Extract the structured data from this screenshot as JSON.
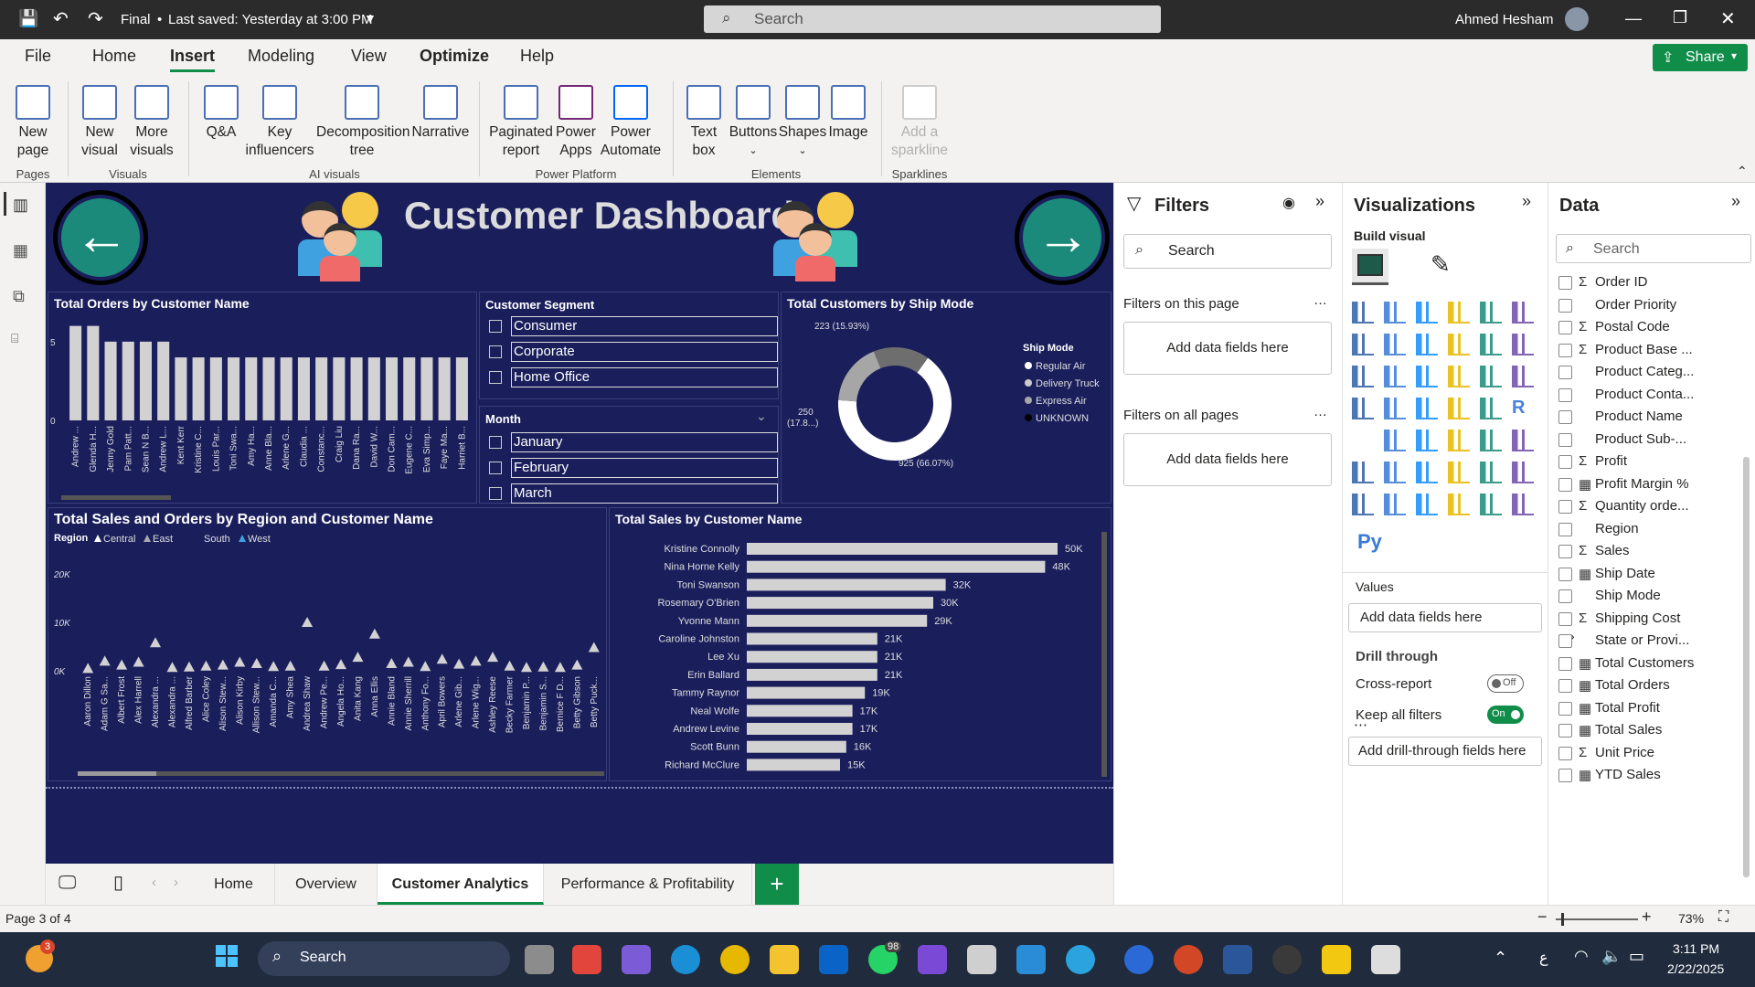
{
  "titlebar": {
    "file_title": "Final",
    "saved": "Last saved: Yesterday at 3:00 PM",
    "search_placeholder": "Search",
    "user": "Ahmed Hesham"
  },
  "ribbon": {
    "tabs": [
      "File",
      "Home",
      "Insert",
      "Modeling",
      "View",
      "Optimize",
      "Help"
    ],
    "selected_tab": "Insert",
    "share": "Share",
    "buttons": {
      "new_page": "New\npage",
      "new_visual": "New\nvisual",
      "more_visuals": "More\nvisuals",
      "qa": "Q&A",
      "key_influencers": "Key\ninfluencers",
      "decomposition": "Decomposition\ntree",
      "narrative": "Narrative",
      "paginated": "Paginated\nreport",
      "power_apps": "Power\nApps",
      "power_automate": "Power\nAutomate",
      "text_box": "Text\nbox",
      "buttons": "Buttons",
      "shapes": "Shapes",
      "image": "Image",
      "sparkline": "Add a\nsparkline"
    },
    "groups": {
      "pages": "Pages",
      "visuals": "Visuals",
      "ai": "AI visuals",
      "power_platform": "Power Platform",
      "elements": "Elements",
      "sparklines": "Sparklines"
    }
  },
  "dashboard": {
    "title": "Customer Dashboard",
    "orders_title": "Total Orders by Customer Name",
    "segment_title": "Customer Segment",
    "segments": [
      "Consumer",
      "Corporate",
      "Home Office"
    ],
    "month_title": "Month",
    "months": [
      "January",
      "February",
      "March"
    ],
    "shipmode_title": "Total Customers by Ship Mode",
    "region_title": "Total Sales and Orders by Region and Customer Name",
    "sales_title": "Total Sales by Customer Name"
  },
  "chart_data": [
    {
      "type": "bar",
      "title": "Total Orders by Customer Name",
      "categories": [
        "Andrew ...",
        "Glenda H...",
        "Jenny Gold",
        "Pam Patt...",
        "Sean N B...",
        "Andrew L...",
        "Kent Kerr",
        "Kristine C...",
        "Louis Par...",
        "Toni Swa...",
        "Amy Ha...",
        "Anne Bla...",
        "Arlene G...",
        "Claudia ...",
        "Constanc...",
        "Craig Liu",
        "Dana Ra...",
        "David W...",
        "Don Cam...",
        "Eugene C...",
        "Eva Simp...",
        "Faye Ma...",
        "Harriet B..."
      ],
      "values": [
        6,
        6,
        5,
        5,
        5,
        5,
        4,
        4,
        4,
        4,
        4,
        4,
        4,
        4,
        4,
        4,
        4,
        4,
        4,
        4,
        4,
        4,
        4
      ],
      "yticks": [
        "0",
        "5"
      ],
      "ylim": [
        0,
        6.5
      ]
    },
    {
      "type": "pie",
      "title": "Total Customers by Ship Mode",
      "legend_title": "Ship Mode",
      "legend": [
        "Regular Air",
        "Delivery Truck",
        "Express Air",
        "UNKNOWN"
      ],
      "labels": [
        "925 (66.07%)",
        "250\n(17.8...)",
        "223 (15.93%)"
      ],
      "values": [
        925,
        250,
        223
      ],
      "colors": [
        "#ffffff",
        "#a6a6a6",
        "#6e6e6e"
      ]
    },
    {
      "type": "scatter",
      "title": "Total Sales and Orders by Region and Customer Name",
      "legend_title": "Region",
      "legend": [
        "Central",
        "East",
        "South",
        "West"
      ],
      "yticks": [
        "0K",
        "10K",
        "20K"
      ],
      "ylim": [
        0,
        22000
      ],
      "categories": [
        "Aaron Dillon",
        "Adam G Sa...",
        "Albert Frost",
        "Alex Harrell",
        "Alexandra ...",
        "Alexandra ...",
        "Alfred Barber",
        "Alice Coley",
        "Alison Stew...",
        "Alison Kirby",
        "Allison Stew...",
        "Amanda C...",
        "Amy Shea",
        "Andrea Shaw",
        "Andrew Pe...",
        "Angela Ho...",
        "Anita Kang",
        "Anna Ellis",
        "Annie Bland",
        "Annie Sherrill",
        "Anthony Fo...",
        "April Bowers",
        "Arlene Gib...",
        "Arlene Wig...",
        "Ashley Reese",
        "Becky Farmer",
        "Benjamin P...",
        "Benjamin S...",
        "Bernice F D...",
        "Betty Gibson",
        "Betty Puck..."
      ],
      "values": [
        500,
        2000,
        1200,
        1800,
        5800,
        700,
        800,
        1000,
        1200,
        1800,
        1500,
        900,
        1000,
        10000,
        1000,
        1300,
        2800,
        7600,
        1500,
        1800,
        900,
        2400,
        1400,
        2000,
        2800,
        1000,
        700,
        800,
        700,
        1200,
        4800
      ]
    },
    {
      "type": "bar",
      "orientation": "horizontal",
      "title": "Total Sales by Customer Name",
      "categories": [
        "Kristine Connolly",
        "Nina Horne Kelly",
        "Toni Swanson",
        "Rosemary O'Brien",
        "Yvonne Mann",
        "Caroline Johnston",
        "Lee Xu",
        "Erin Ballard",
        "Tammy Raynor",
        "Neal Wolfe",
        "Andrew Levine",
        "Scott Bunn",
        "Richard McClure"
      ],
      "values": [
        50,
        48,
        32,
        30,
        29,
        21,
        21,
        21,
        19,
        17,
        17,
        16,
        15
      ],
      "data_labels": [
        "50K",
        "48K",
        "32K",
        "30K",
        "29K",
        "21K",
        "21K",
        "21K",
        "19K",
        "17K",
        "17K",
        "16K",
        "15K"
      ],
      "units": "K"
    }
  ],
  "filters": {
    "title": "Filters",
    "search": "Search",
    "page_label": "Filters on this page",
    "all_label": "Filters on all pages",
    "add": "Add data fields here"
  },
  "viz": {
    "title": "Visualizations",
    "build": "Build visual",
    "values": "Values",
    "add_values": "Add data fields here",
    "drill": "Drill through",
    "cross": "Cross-report",
    "cross_state": "Off",
    "keep": "Keep all filters",
    "keep_state": "On",
    "add_drill": "Add drill-through fields here",
    "extra": "R",
    "py": "Py"
  },
  "data": {
    "title": "Data",
    "search": "Search",
    "fields": [
      {
        "sigma": true,
        "name": "Order ID"
      },
      {
        "sigma": false,
        "name": "Order Priority"
      },
      {
        "sigma": true,
        "name": "Postal Code"
      },
      {
        "sigma": true,
        "name": "Product Base ..."
      },
      {
        "sigma": false,
        "name": "Product Categ..."
      },
      {
        "sigma": false,
        "name": "Product Conta..."
      },
      {
        "sigma": false,
        "name": "Product Name"
      },
      {
        "sigma": false,
        "name": "Product Sub-..."
      },
      {
        "sigma": true,
        "name": "Profit"
      },
      {
        "sigma": false,
        "calc": true,
        "name": "Profit Margin %"
      },
      {
        "sigma": true,
        "name": "Quantity orde..."
      },
      {
        "sigma": false,
        "name": "Region"
      },
      {
        "sigma": true,
        "name": "Sales"
      },
      {
        "sigma": false,
        "calc": true,
        "name": "Ship Date"
      },
      {
        "sigma": false,
        "name": "Ship Mode"
      },
      {
        "sigma": true,
        "name": "Shipping Cost"
      },
      {
        "sigma": false,
        "name": "State or Provi..."
      },
      {
        "sigma": false,
        "calc": true,
        "name": "Total Customers"
      },
      {
        "sigma": false,
        "calc": true,
        "name": "Total Orders"
      },
      {
        "sigma": false,
        "calc": true,
        "name": "Total Profit"
      },
      {
        "sigma": false,
        "calc": true,
        "name": "Total Sales"
      },
      {
        "sigma": true,
        "name": "Unit Price"
      },
      {
        "sigma": false,
        "calc": true,
        "name": "YTD Sales"
      }
    ]
  },
  "pagetabs": [
    "Home",
    "Overview",
    "Customer Analytics",
    "Performance & Profitability"
  ],
  "selected_page": "Customer Analytics",
  "status": {
    "page": "Page 3 of 4",
    "zoom": "73%"
  },
  "taskbar": {
    "search": "Search",
    "time": "3:11 PM",
    "date": "2/22/2025",
    "badge": "3",
    "whatsapp_badge": "98",
    "lang": "ع"
  }
}
